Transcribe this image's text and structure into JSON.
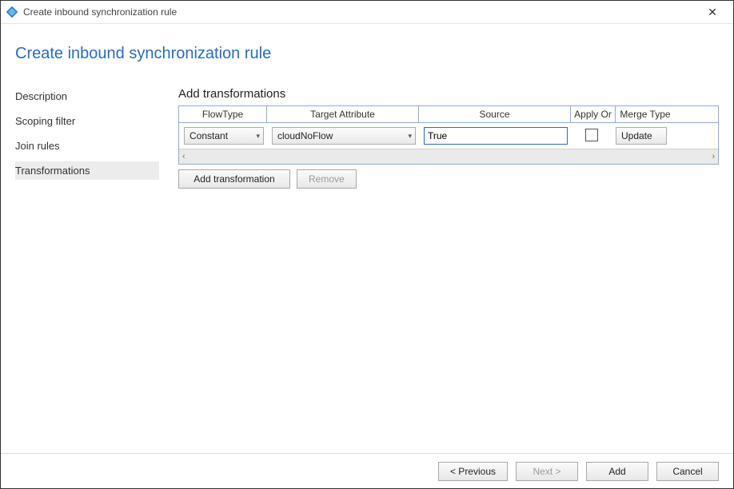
{
  "window": {
    "title": "Create inbound synchronization rule",
    "close_label": "✕"
  },
  "heading": "Create inbound synchronization rule",
  "nav": {
    "items": [
      {
        "label": "Description",
        "active": false
      },
      {
        "label": "Scoping filter",
        "active": false
      },
      {
        "label": "Join rules",
        "active": false
      },
      {
        "label": "Transformations",
        "active": true
      }
    ]
  },
  "main": {
    "section_title": "Add transformations",
    "columns": {
      "flowtype": "FlowType",
      "target": "Target Attribute",
      "source": "Source",
      "apply": "Apply Or",
      "merge": "Merge Type"
    },
    "row": {
      "flowtype": "Constant",
      "target": "cloudNoFlow",
      "source": "True",
      "apply_checked": false,
      "merge": "Update"
    },
    "buttons": {
      "add_transformation": "Add transformation",
      "remove": "Remove"
    },
    "scroll": {
      "left": "‹",
      "right": "›"
    }
  },
  "footer": {
    "previous": "< Previous",
    "next": "Next >",
    "add": "Add",
    "cancel": "Cancel"
  }
}
